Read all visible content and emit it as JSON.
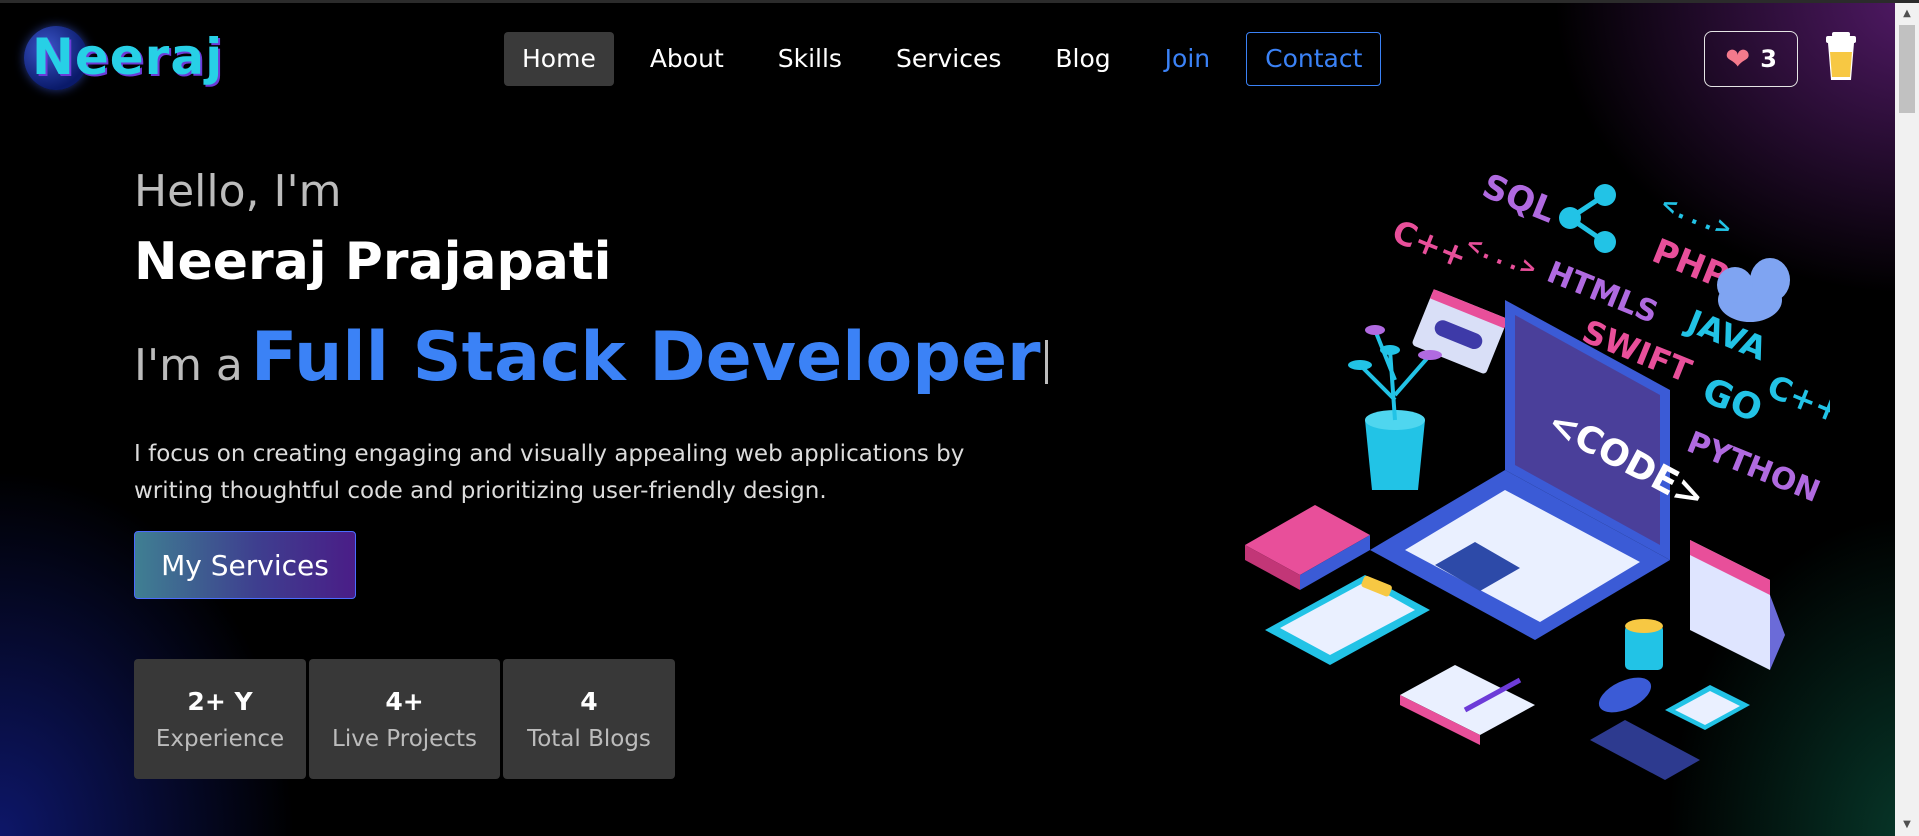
{
  "header": {
    "logo": "Neeraj",
    "nav": [
      {
        "label": "Home",
        "active": true
      },
      {
        "label": "About"
      },
      {
        "label": "Skills"
      },
      {
        "label": "Services"
      },
      {
        "label": "Blog"
      },
      {
        "label": "Join"
      },
      {
        "label": "Contact"
      }
    ],
    "likes_count": "3",
    "icons": {
      "likes": "heart-icon",
      "coffee": "coffee-cup-icon"
    }
  },
  "hero": {
    "greeting": "Hello, I'm",
    "name": "Neeraj Prajapati",
    "role_prefix": "I'm a",
    "role_title": "Full Stack Developer",
    "description_line1": "I focus on creating engaging and visually appealing web applications by",
    "description_line2": "writing thoughtful code and prioritizing user-friendly design.",
    "cta_label": "My Services",
    "stats": [
      {
        "value": "2+ Y",
        "label": "Experience"
      },
      {
        "value": "4+",
        "label": "Live Projects"
      },
      {
        "value": "4",
        "label": "Total Blogs"
      }
    ]
  },
  "illustration": {
    "tags": [
      "SQL",
      "PHP",
      "C++",
      "HTMLS",
      "SWIFT",
      "JAVA",
      "GO",
      "C++",
      "PYTHON",
      "<CODE>"
    ],
    "colors": {
      "accent": "#3b82f6",
      "pink": "#e84f9a",
      "purple": "#b06ae0",
      "cyan": "#22c3e6"
    }
  }
}
